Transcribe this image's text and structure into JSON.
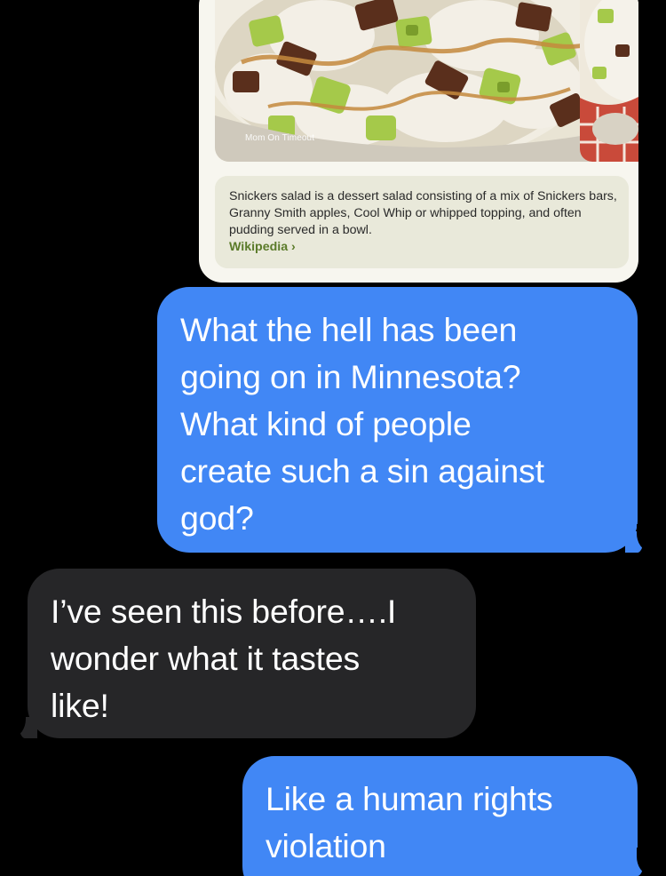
{
  "shared_card": {
    "image_source": "Mom On Timeout",
    "description": "Snickers salad is a dessert salad consisting of a mix of Snickers bars, Granny Smith apples, Cool Whip or whipped topping, and often pudding served in a bowl.",
    "link_label": "Wikipedia ›"
  },
  "messages": [
    {
      "direction": "sent",
      "text": "What the hell has been\ngoing on in Minnesota?\nWhat kind of people\ncreate such a sin against\ngod?"
    },
    {
      "direction": "received",
      "text": "I’ve seen this before….I\nwonder what it tastes\nlike!"
    },
    {
      "direction": "sent",
      "text": "Like a human rights\nviolation"
    }
  ],
  "colors": {
    "background": "#000000",
    "sent_bubble": "#4187f5",
    "received_bubble": "#262628",
    "card_background": "#f7f6ef",
    "info_box": "#e9e9da",
    "link": "#5b7b2a"
  }
}
